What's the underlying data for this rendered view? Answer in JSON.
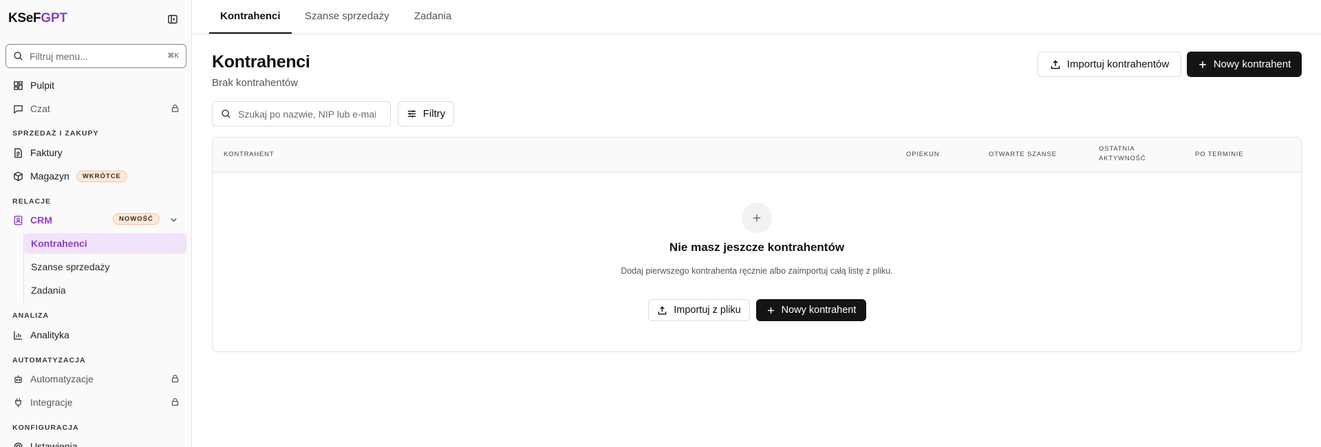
{
  "app": {
    "logo_main": "KSeF",
    "logo_accent": "GPT"
  },
  "sidebar": {
    "filter_placeholder": "Filtruj menu...",
    "filter_shortcut": "⌘K",
    "items": {
      "pulpit": "Pulpit",
      "czat": "Czat",
      "faktury": "Faktury",
      "magazyn": "Magazyn",
      "magazyn_badge": "WKRÓTCE",
      "crm": "CRM",
      "crm_badge": "NOWOŚĆ",
      "kontrahenci": "Kontrahenci",
      "szanse": "Szanse sprzedaży",
      "zadania": "Zadania",
      "analityka": "Analityka",
      "automatyzacje": "Automatyzacje",
      "integracje": "Integracje",
      "ustawienia": "Ustawienia"
    },
    "sections": {
      "sprzedaz": "SPRZEDAŻ I ZAKUPY",
      "relacje": "RELACJE",
      "analiza": "ANALIZA",
      "automatyzacja": "AUTOMATYZACJA",
      "konfiguracja": "KONFIGURACJA"
    }
  },
  "tabs": [
    "Kontrahenci",
    "Szanse sprzedaży",
    "Zadania"
  ],
  "header": {
    "title": "Kontrahenci",
    "subtitle": "Brak kontrahentów",
    "import_label": "Importuj kontrahentów",
    "new_label": "Nowy kontrahent"
  },
  "toolbar": {
    "search_placeholder": "Szukaj po nazwie, NIP lub e-mail",
    "filters_label": "Filtry"
  },
  "table": {
    "columns": [
      "KONTRAHENT",
      "OPIEKUN",
      "OTWARTE SZANSE",
      "OSTATNIA AKTYWNOŚĆ",
      "PO TERMINIE"
    ]
  },
  "empty": {
    "title": "Nie masz jeszcze kontrahentów",
    "description": "Dodaj pierwszego kontrahenta ręcznie albo zaimportuj całą listę z pliku.",
    "import_label": "Importuj z pliku",
    "new_label": "Nowy kontrahent"
  },
  "colors": {
    "accent": "#8b3fc7",
    "dark_button": "#141414",
    "active_bg": "#f1e4fa"
  }
}
